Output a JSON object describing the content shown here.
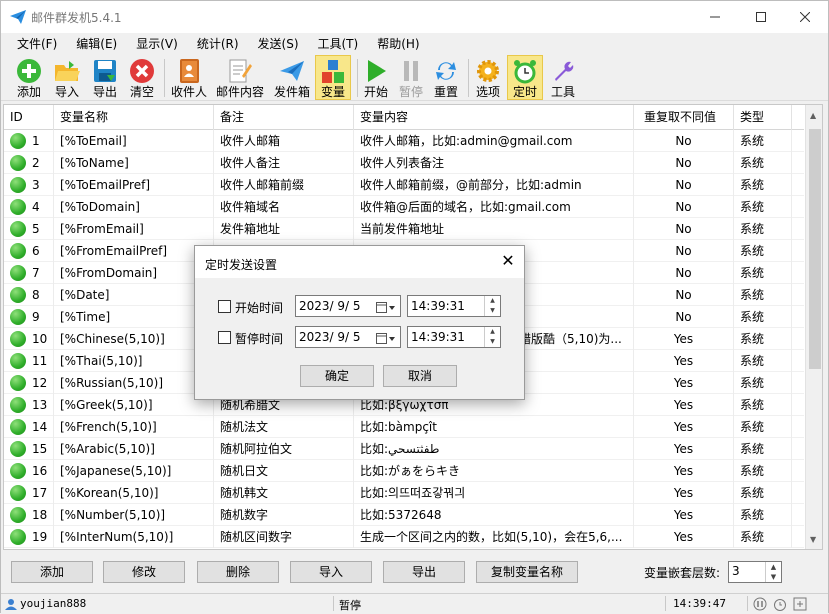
{
  "window": {
    "title": "邮件群发机5.4.1"
  },
  "menu": [
    "文件(F)",
    "编辑(E)",
    "显示(V)",
    "统计(R)",
    "发送(S)",
    "工具(T)",
    "帮助(H)"
  ],
  "toolbar": {
    "add": "添加",
    "import": "导入",
    "export": "导出",
    "clear": "清空",
    "recipients": "收件人",
    "content": "邮件内容",
    "senders": "发件箱",
    "variables": "变量",
    "start": "开始",
    "pause": "暂停",
    "reset": "重置",
    "options": "选项",
    "timer": "定时",
    "tools": "工具"
  },
  "grid": {
    "headers": [
      "ID",
      "变量名称",
      "备注",
      "变量内容",
      "重复取不同值",
      "类型"
    ],
    "rows": [
      [
        "1",
        "[%ToEmail]",
        "收件人邮箱",
        "收件人邮箱，比如:admin@gmail.com",
        "No",
        "系统"
      ],
      [
        "2",
        "[%ToName]",
        "收件人备注",
        "收件人列表备注",
        "No",
        "系统"
      ],
      [
        "3",
        "[%ToEmailPref]",
        "收件人邮箱前缀",
        "收件人邮箱前缀，@前部分，比如:admin",
        "No",
        "系统"
      ],
      [
        "4",
        "[%ToDomain]",
        "收件箱域名",
        "收件箱@后面的域名，比如:gmail.com",
        "No",
        "系统"
      ],
      [
        "5",
        "[%FromEmail]",
        "发件箱地址",
        "当前发件箱地址",
        "No",
        "系统"
      ],
      [
        "6",
        "[%FromEmailPref]",
        "",
        "",
        "No",
        "系统"
      ],
      [
        "7",
        "[%FromDomain]",
        "",
        "",
        "No",
        "系统"
      ],
      [
        "8",
        "[%Date]",
        "",
        "",
        "No",
        "系统"
      ],
      [
        "9",
        "[%Time]",
        "",
        "",
        "No",
        "系统"
      ],
      [
        "10",
        "[%Chinese(5,10)]",
        "",
        "",
        "Yes",
        "系统"
      ],
      [
        "11",
        "[%Thai(5,10)]",
        "",
        "",
        "Yes",
        "系统"
      ],
      [
        "12",
        "[%Russian(5,10)]",
        "",
        "",
        "Yes",
        "系统"
      ],
      [
        "13",
        "[%Greek(5,10)]",
        "随机希腊文",
        "比如:βξγωχτσπ",
        "Yes",
        "系统"
      ],
      [
        "14",
        "[%French(5,10)]",
        "随机法文",
        "比如:bàmpçît",
        "Yes",
        "系统"
      ],
      [
        "15",
        "[%Arabic(5,10)]",
        "随机阿拉伯文",
        "比如:طفثتسحي",
        "Yes",
        "系统"
      ],
      [
        "16",
        "[%Japanese(5,10)]",
        "随机日文",
        "比如:がぁをらキき",
        "Yes",
        "系统"
      ],
      [
        "17",
        "[%Korean(5,10)]",
        "随机韩文",
        "比如:의뜨떠죠갛꿔긔",
        "Yes",
        "系统"
      ],
      [
        "18",
        "[%Number(5,10)]",
        "随机数字",
        "比如:5372648",
        "Yes",
        "系统"
      ],
      [
        "19",
        "[%InterNum(5,10)]",
        "随机区间数字",
        "生成一个区间之内的数，比如(5,10)，会在5,6,...",
        "Yes",
        "系统"
      ]
    ],
    "row10_partial": "错版酷（5,10)为..."
  },
  "bottom": {
    "add": "添加",
    "edit": "修改",
    "delete": "删除",
    "import": "导入",
    "export": "导出",
    "copy_name": "复制变量名称",
    "depth_label": "变量嵌套层数:",
    "depth_value": "3"
  },
  "status": {
    "user": "youjian888",
    "state": "暂停",
    "time": "14:39:47"
  },
  "dialog": {
    "title": "定时发送设置",
    "start_label": "开始时间",
    "start_date": "2023/ 9/ 5",
    "start_time": "14:39:31",
    "pause_label": "暂停时间",
    "pause_date": "2023/ 9/ 5",
    "pause_time": "14:39:31",
    "ok": "确定",
    "cancel": "取消"
  }
}
